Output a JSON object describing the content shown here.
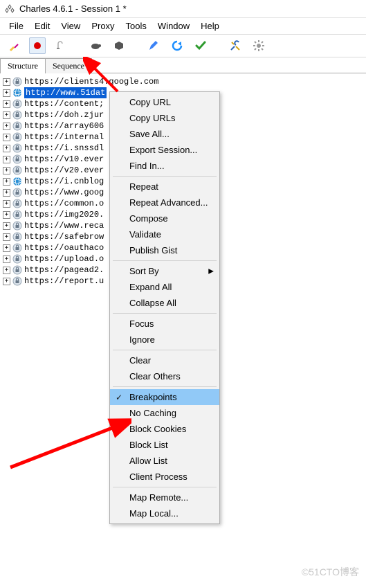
{
  "title": "Charles 4.6.1 - Session 1 *",
  "menu": [
    "File",
    "Edit",
    "View",
    "Proxy",
    "Tools",
    "Window",
    "Help"
  ],
  "tabs": {
    "structure": "Structure",
    "sequence": "Sequence",
    "active": "structure"
  },
  "tree": [
    {
      "url": "https://clients4.google.com",
      "icon": "lock",
      "selected": false
    },
    {
      "url": "http://www.51dat",
      "icon": "globe",
      "selected": true
    },
    {
      "url": "https://content;",
      "icon": "lock",
      "selected": false
    },
    {
      "url": "https://doh.zjur",
      "icon": "lock",
      "selected": false
    },
    {
      "url": "https://array606",
      "icon": "lock",
      "selected": false
    },
    {
      "url": "https://internal",
      "icon": "lock",
      "selected": false
    },
    {
      "url": "https://i.snssdl",
      "icon": "lock",
      "selected": false
    },
    {
      "url": "https://v10.ever",
      "icon": "lock",
      "selected": false
    },
    {
      "url": "https://v20.ever",
      "icon": "lock",
      "selected": false
    },
    {
      "url": "https://i.cnblog",
      "icon": "globe-alt",
      "selected": false
    },
    {
      "url": "https://www.goog",
      "icon": "lock",
      "selected": false
    },
    {
      "url": "https://common.o",
      "icon": "lock",
      "selected": false
    },
    {
      "url": "https://img2020.",
      "icon": "lock",
      "selected": false
    },
    {
      "url": "https://www.reca",
      "icon": "lock",
      "selected": false
    },
    {
      "url": "https://safebrow",
      "icon": "lock",
      "selected": false
    },
    {
      "url": "https://oauthaco",
      "icon": "lock",
      "selected": false
    },
    {
      "url": "https://upload.o",
      "icon": "lock",
      "selected": false
    },
    {
      "url": "https://pagead2.",
      "icon": "lock",
      "selected": false
    },
    {
      "url": "https://report.u",
      "icon": "lock",
      "selected": false
    }
  ],
  "contextMenu": {
    "groups": [
      [
        "Copy URL",
        "Copy URLs",
        "Save All...",
        "Export Session...",
        "Find In..."
      ],
      [
        "Repeat",
        "Repeat Advanced...",
        "Compose",
        "Validate",
        "Publish Gist"
      ],
      [
        {
          "label": "Sort By",
          "submenu": true
        },
        "Expand All",
        "Collapse All"
      ],
      [
        "Focus",
        "Ignore"
      ],
      [
        "Clear",
        "Clear Others"
      ],
      [
        {
          "label": "Breakpoints",
          "checked": true,
          "highlighted": true
        },
        "No Caching",
        "Block Cookies",
        "Block List",
        "Allow List",
        "Client Process"
      ],
      [
        "Map Remote...",
        "Map Local..."
      ]
    ]
  },
  "watermark": "©51CTO博客"
}
